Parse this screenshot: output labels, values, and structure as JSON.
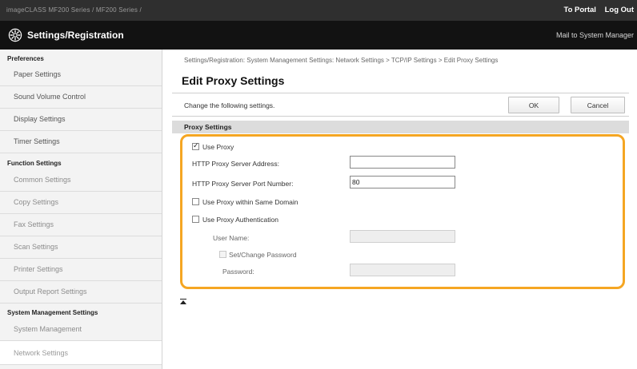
{
  "topbar": {
    "crumb": "imageCLASS   MF200 Series / MF200 Series /",
    "portal_link": "To Portal",
    "logout_link": "Log Out"
  },
  "header": {
    "title": "Settings/Registration",
    "mail_link": "Mail to System Manager",
    "icon": "settings-gear-icon"
  },
  "sidebar": {
    "sections": [
      {
        "title": "Preferences",
        "items": [
          "Paper Settings",
          "Sound Volume Control",
          "Display Settings",
          "Timer Settings"
        ]
      },
      {
        "title": "Function Settings",
        "items": [
          "Common Settings",
          "Copy Settings",
          "Fax Settings",
          "Scan Settings",
          "Printer Settings",
          "Output Report Settings"
        ]
      },
      {
        "title": "System Management Settings",
        "items": [
          "System Management",
          "Network Settings"
        ]
      }
    ]
  },
  "main": {
    "breadcrumb": "Settings/Registration: System Management Settings: Network Settings > TCP/IP Settings > Edit Proxy Settings",
    "title": "Edit Proxy Settings",
    "instruction": "Change the following settings.",
    "ok_label": "OK",
    "cancel_label": "Cancel",
    "section_title": "Proxy Settings",
    "use_proxy": {
      "label": "Use Proxy",
      "checked": true
    },
    "http_address": {
      "label": "HTTP Proxy Server Address:",
      "value": ""
    },
    "http_port": {
      "label": "HTTP Proxy Server Port Number:",
      "value": "80"
    },
    "same_domain": {
      "label": "Use Proxy within Same Domain",
      "checked": false
    },
    "auth": {
      "label": "Use Proxy Authentication",
      "checked": false
    },
    "user_name": {
      "label": "User Name:",
      "value": ""
    },
    "set_password": {
      "label": "Set/Change Password",
      "checked": false
    },
    "password": {
      "label": "Password:",
      "value": ""
    }
  },
  "colors": {
    "highlight_border": "#f5a623",
    "header_bg": "#121212",
    "topbar_bg": "#2f2f2f"
  }
}
